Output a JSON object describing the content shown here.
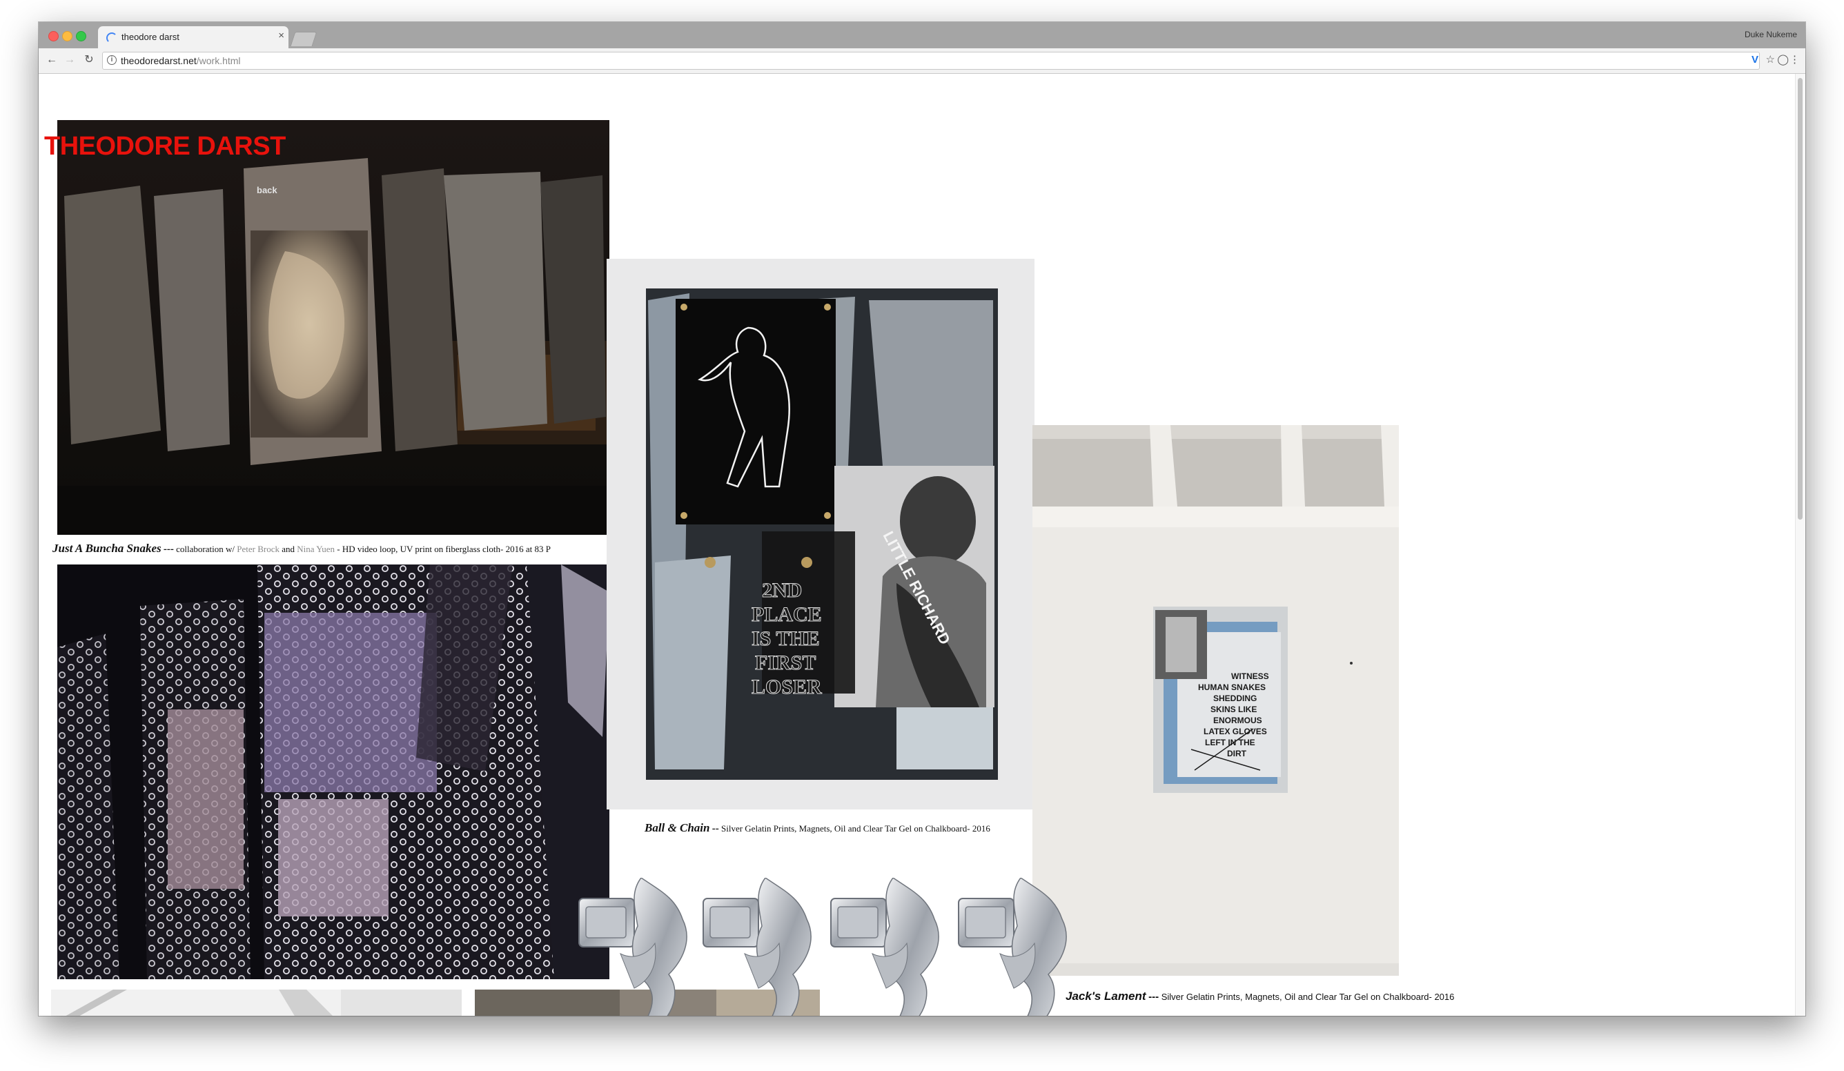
{
  "browser": {
    "tab_title": "theodore darst",
    "profile_name": "Duke Nukeme",
    "url_domain": "theodoredarst.net",
    "url_path": "/work.html",
    "icons": {
      "back": "arrow-left-icon",
      "forward": "arrow-right-icon",
      "reload": "reload-icon",
      "info": "info-icon",
      "extension": "vimeo-extension-icon",
      "bookmark": "star-icon",
      "shield": "shield-extension-icon",
      "menu": "kebab-menu-icon"
    }
  },
  "site": {
    "logo": "THEODORE DARST",
    "logo_color": "#e8120c",
    "back_link": "back"
  },
  "works": [
    {
      "title": "Just A Buncha Snakes",
      "separator": "---",
      "pre": " collaboration w/ ",
      "collaborator1": "Peter Brock",
      "and": " and ",
      "collaborator2": "Nina Yuen",
      "detail": " - HD video loop, UV print on fiberglass cloth- 2016 at 83 P"
    },
    {
      "title": "Ball & Chain",
      "separator": "--",
      "detail": " Silver Gelatin Prints, Magnets, Oil and Clear Tar Gel on Chalkboard- 2016",
      "painting_text": [
        "2ND",
        "PLACE",
        "IS THE",
        "FIRST",
        "LOSER"
      ],
      "banner_text": "LITTLE RICHARD"
    },
    {
      "title": "Jack's Lament",
      "separator": "---",
      "detail": " Silver Gelatin Prints, Magnets, Oil and Clear Tar Gel on Chalkboard- 2016",
      "painting_text": [
        "WITNESS",
        "HUMAN SNAKES",
        "SHEDDING",
        "SKINS LIKE",
        "ENORMOUS",
        "LATEX GLOVES",
        "LEFT IN THE",
        "DIRT"
      ]
    }
  ]
}
